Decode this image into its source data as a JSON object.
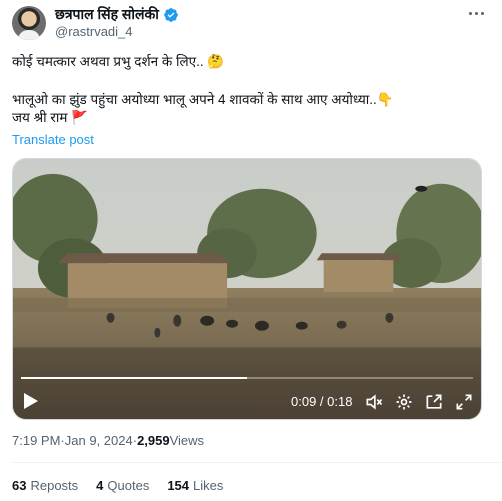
{
  "author": {
    "display_name": "छत्रपाल सिंह सोलंकी",
    "handle": "@rastrvadi_4"
  },
  "tweet": {
    "line1": "कोई चमत्कार अथवा प्रभु दर्शन के लिए..",
    "line1_emoji": "🤔",
    "line2": "भालूओ का झुंड पहुंचा अयोध्या भालू अपने 4 शावकों के साथ आए अयोध्या..",
    "line2_emoji": "👇",
    "line3": "जय श्री राम",
    "line3_emoji": "🚩",
    "translate_label": "Translate post"
  },
  "video": {
    "time_display": "0:09 / 0:18",
    "progress": 0.5
  },
  "meta": {
    "time": "7:19 PM",
    "separator": " · ",
    "date": "Jan 9, 2024",
    "views_count": "2,959",
    "views_label": " Views"
  },
  "stats": {
    "reposts_count": "63",
    "reposts_label": "Reposts",
    "quotes_count": "4",
    "quotes_label": "Quotes",
    "likes_count": "154",
    "likes_label": "Likes"
  },
  "icons": [
    "verified-badge-icon",
    "more-icon",
    "play-icon",
    "mute-icon",
    "settings-icon",
    "pip-icon",
    "fullscreen-icon"
  ],
  "colors": {
    "accent": "#1d9bf0",
    "text": "#0f1419",
    "secondary": "#536471"
  }
}
